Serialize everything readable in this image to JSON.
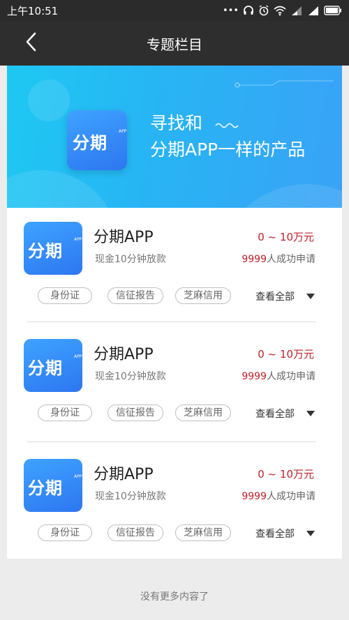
{
  "status_bar": {
    "time": "上午10:51",
    "icons": [
      "dots-icon",
      "headphones-icon",
      "alarm-icon",
      "wifi-icon",
      "signal-icon",
      "signal-icon",
      "battery-icon"
    ]
  },
  "nav": {
    "title": "专题栏目"
  },
  "banner": {
    "logo_text": "分期",
    "logo_sub": "APP",
    "line1": "寻找和",
    "line2": "分期APP一样的产品"
  },
  "items": [
    {
      "logo_text": "分期",
      "logo_sub": "APP",
      "name": "分期APP",
      "range": "0 ~ 10万元",
      "desc": "现金10分钟放款",
      "count_num": "9999",
      "count_suffix": "人成功申请",
      "tags": [
        "身份证",
        "信征报告",
        "芝麻信用"
      ],
      "view_all": "查看全部"
    },
    {
      "logo_text": "分期",
      "logo_sub": "APP",
      "name": "分期APP",
      "range": "0 ~ 10万元",
      "desc": "现金10分钟放款",
      "count_num": "9999",
      "count_suffix": "人成功申请",
      "tags": [
        "身份证",
        "信征报告",
        "芝麻信用"
      ],
      "view_all": "查看全部"
    },
    {
      "logo_text": "分期",
      "logo_sub": "APP",
      "name": "分期APP",
      "range": "0 ~ 10万元",
      "desc": "现金10分钟放款",
      "count_num": "9999",
      "count_suffix": "人成功申请",
      "tags": [
        "身份证",
        "信征报告",
        "芝麻信用"
      ],
      "view_all": "查看全部"
    }
  ],
  "footer": {
    "text": "没有更多内容了"
  },
  "colors": {
    "accent_red": "#c0202a",
    "banner_start": "#1ec8f2",
    "banner_end": "#3aa2f6",
    "logo_blue": "#2e76f0",
    "bar_dark": "#2e2e2e"
  }
}
